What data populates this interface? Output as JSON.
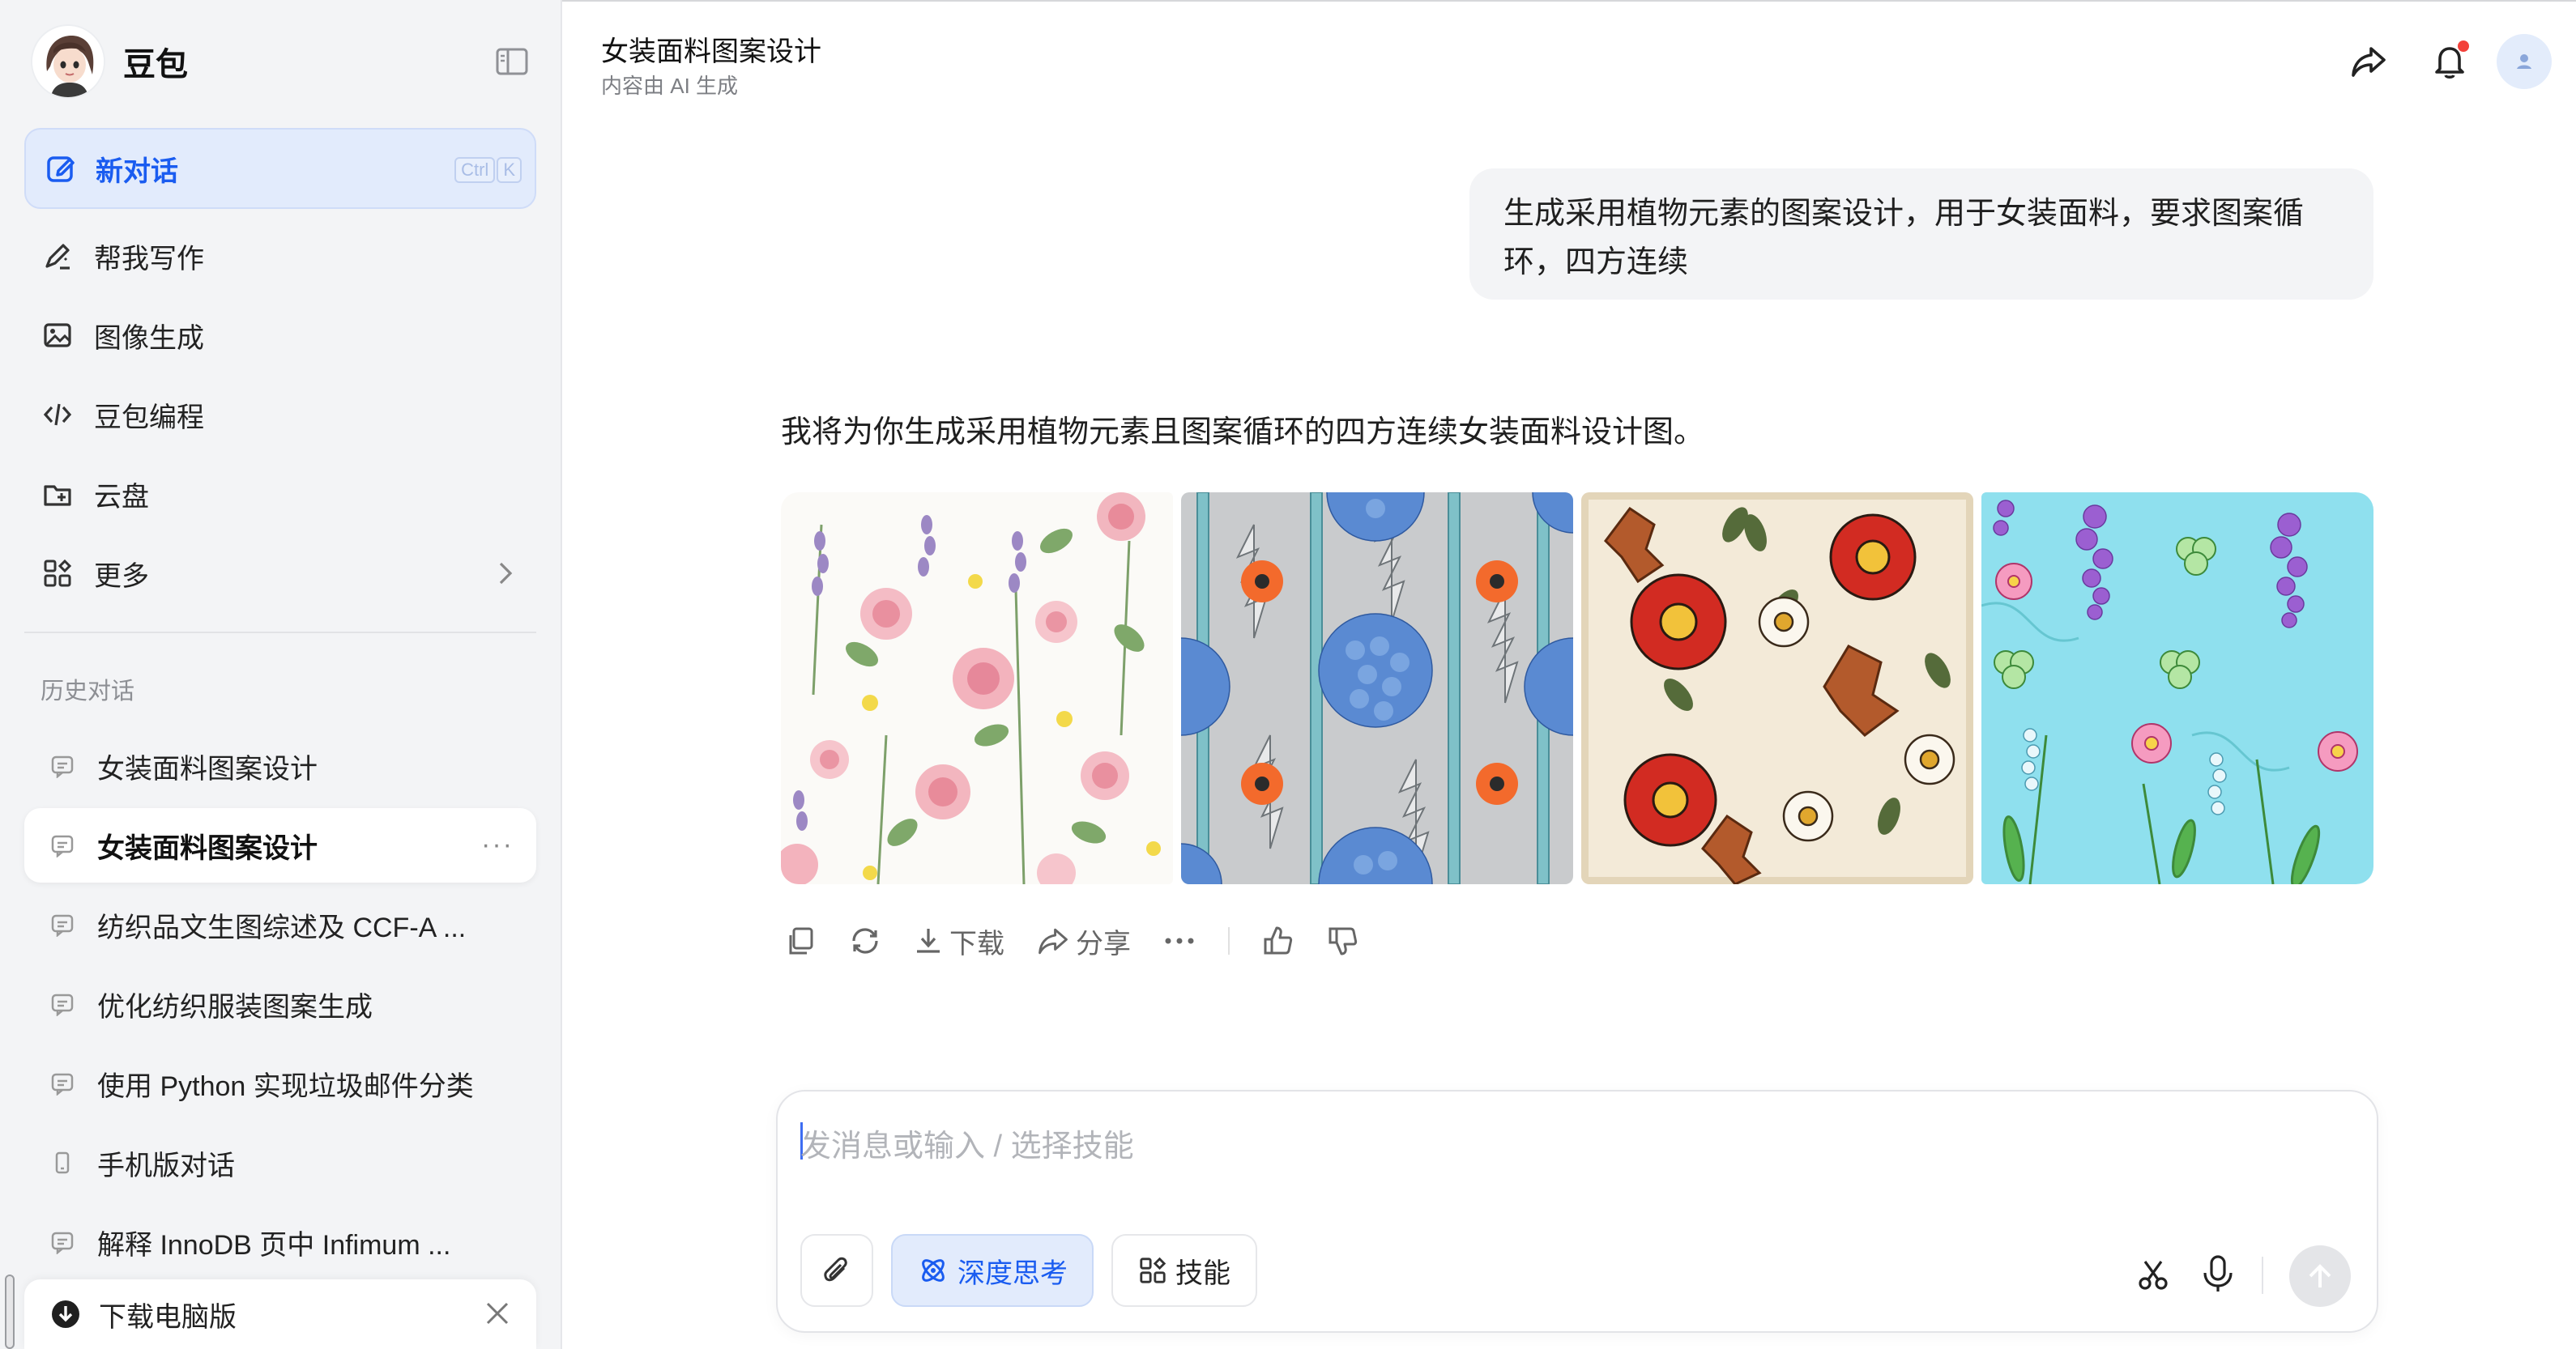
{
  "app": {
    "name": "豆包"
  },
  "sidebar": {
    "new_chat": {
      "label": "新对话",
      "shortcut": [
        "Ctrl",
        "K"
      ]
    },
    "nav": [
      {
        "label": "帮我写作",
        "icon": "pen-icon"
      },
      {
        "label": "图像生成",
        "icon": "image-icon"
      },
      {
        "label": "豆包编程",
        "icon": "code-icon"
      },
      {
        "label": "云盘",
        "icon": "cloud-folder-icon"
      },
      {
        "label": "更多",
        "icon": "apps-icon"
      }
    ],
    "history_title": "历史对话",
    "history": [
      {
        "label": "女装面料图案设计"
      },
      {
        "label": "女装面料图案设计",
        "active": true
      },
      {
        "label": "纺织品文生图综述及 CCF-A ..."
      },
      {
        "label": "优化纺织服装图案生成"
      },
      {
        "label": "使用 Python 实现垃圾邮件分类"
      },
      {
        "label": "手机版对话"
      },
      {
        "label": "解释 InnoDB 页中 Infimum ..."
      }
    ],
    "download": {
      "label": "下载电脑版"
    }
  },
  "header": {
    "title": "女装面料图案设计",
    "subtitle": "内容由 AI 生成"
  },
  "conversation": {
    "user_message": "生成采用植物元素的图案设计，用于女装面料，要求图案循环，四方连续",
    "reply_text": "我将为你生成采用植物元素且图案循环的四方连续女装面料设计图。",
    "images": [
      {
        "theme": "watercolor roses, lavender and dandelion on white"
      },
      {
        "theme": "blue hydrangea, orange poppies and silver ferns on grey"
      },
      {
        "theme": "red camellias, daisies and autumn leaves on cream"
      },
      {
        "theme": "wisteria, clover and pink flowers on light blue"
      }
    ],
    "actions": {
      "download": "下载",
      "share": "分享"
    }
  },
  "composer": {
    "placeholder": "发消息或输入 / 选择技能",
    "deep_think": "深度思考",
    "skills": "技能"
  },
  "colors": {
    "accent": "#1a5cf0",
    "sidebar_bg": "#f3f4f6",
    "active_bg": "#e2ebfc",
    "notification": "#f3413a"
  }
}
